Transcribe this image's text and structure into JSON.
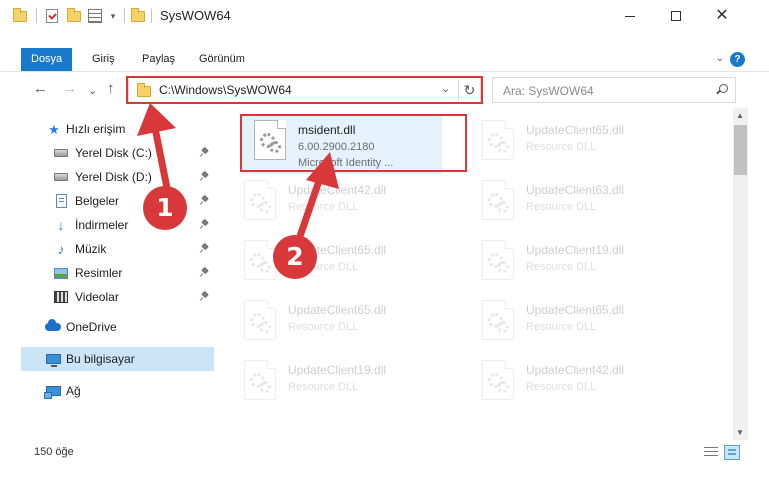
{
  "window": {
    "title": "SysWOW64",
    "qa_dropdown": "▾",
    "controls": {
      "minimize": "—",
      "maximize": "☐",
      "close": "✕"
    }
  },
  "ribbon": {
    "tabs": [
      {
        "label": "Dosya",
        "active": true
      },
      {
        "label": "Giriş",
        "active": false
      },
      {
        "label": "Paylaş",
        "active": false
      },
      {
        "label": "Görünüm",
        "active": false
      }
    ],
    "expand_glyph": "⌄",
    "help_glyph": "?"
  },
  "nav": {
    "back": "←",
    "forward": "→",
    "recent": "⌄",
    "up": "↑"
  },
  "address": {
    "path": "C:\\Windows\\SysWOW64",
    "dropdown": "⌄",
    "refresh": "↻"
  },
  "search": {
    "placeholder": "Ara: SysWOW64"
  },
  "sidebar": {
    "items": [
      {
        "label": "Hızlı erişim",
        "icon": "star-icon"
      },
      {
        "label": "Yerel Disk (C:)",
        "icon": "disk-icon",
        "pinned": true
      },
      {
        "label": "Yerel Disk (D:)",
        "icon": "disk-icon",
        "pinned": true
      },
      {
        "label": "Belgeler",
        "icon": "documents-icon",
        "pinned": true
      },
      {
        "label": "İndirmeler",
        "icon": "downloads-icon",
        "pinned": true
      },
      {
        "label": "Müzik",
        "icon": "music-icon",
        "pinned": true
      },
      {
        "label": "Resimler",
        "icon": "pictures-icon",
        "pinned": true
      },
      {
        "label": "Videolar",
        "icon": "videos-icon",
        "pinned": true
      },
      {
        "label": "OneDrive",
        "icon": "onedrive-icon"
      },
      {
        "label": "Bu bilgisayar",
        "icon": "this-pc-icon",
        "selected": true
      },
      {
        "label": "Ağ",
        "icon": "network-icon"
      }
    ]
  },
  "files": [
    {
      "name": "msident.dll",
      "line2": "6.00.2900.2180",
      "line3": "Microsoft Identity ...",
      "highlighted": true
    },
    {
      "name": "UpdateClient65.dll",
      "line2": "Resource DLL"
    },
    {
      "name": "UpdateClient42.dll",
      "line2": "Resource DLL"
    },
    {
      "name": "UpdateClient63.dll",
      "line2": "Resource DLL"
    },
    {
      "name": "UpdateClient65.dll",
      "line2": "Resource DLL"
    },
    {
      "name": "UpdateClient19.dll",
      "line2": "Resource DLL"
    },
    {
      "name": "UpdateClient65.dll",
      "line2": "Resource DLL"
    },
    {
      "name": "UpdateClient65.dll",
      "line2": "Resource DLL"
    },
    {
      "name": "UpdateClient19.dll",
      "line2": "Resource DLL"
    },
    {
      "name": "UpdateClient42.dll",
      "line2": "Resource DLL"
    }
  ],
  "status": {
    "item_count": "150 öğe"
  },
  "annotations": {
    "badge_1": "1",
    "badge_2": "2",
    "color": "#d9383a"
  },
  "colors": {
    "accent": "#1979ca",
    "selection": "#cce4f7"
  }
}
